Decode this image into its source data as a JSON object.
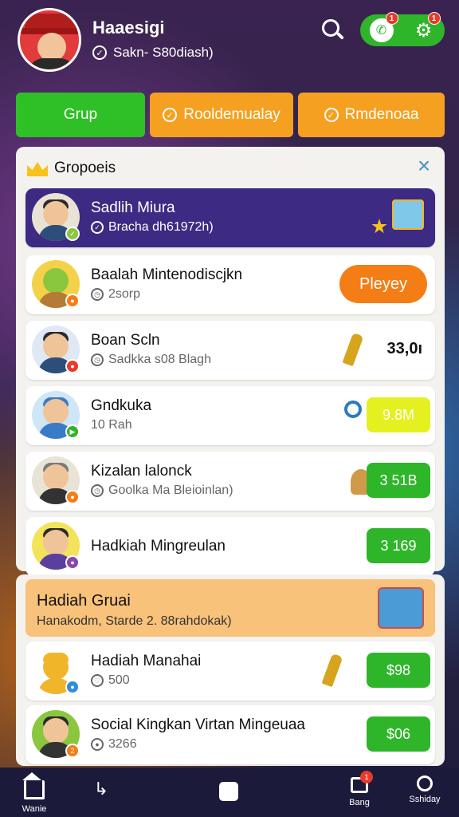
{
  "profile": {
    "name": "Haaesigi",
    "subtitle": "Sakn- S80diash)",
    "subtitle_icon": "check-circle-icon"
  },
  "header_actions": {
    "search_icon": "search-icon",
    "left_badge": "1",
    "right_badge": "1",
    "left_icon": "phone-icon",
    "right_icon": "gear-icon"
  },
  "tabs": [
    {
      "label": "Grup",
      "color": "#2fbf27"
    },
    {
      "label": "Rooldemualay",
      "color": "#f5a020"
    },
    {
      "label": "Rmdenoaa",
      "color": "#f5a020"
    }
  ],
  "panel": {
    "title": "Gropoeis",
    "rows": [
      {
        "title": "Sadlih Miura",
        "subtitle": "Bracha dh61972h)",
        "featured": true
      },
      {
        "title": "Baalah Mintenodiscjkn",
        "subtitle": "2sorp",
        "action": "Pleyey"
      },
      {
        "title": "Boan Scln",
        "subtitle": "Sadkka s08 Blagh",
        "value": "33,0ı"
      },
      {
        "title": "Gndkuka",
        "subtitle": "10 Rah",
        "action": "9.8M"
      },
      {
        "title": "Kizalan lalonck",
        "subtitle": "Goolka Ma Bleioinlan)",
        "action": "3 51B"
      },
      {
        "title": "Hadkiah Mingreulan",
        "action": "3 169"
      }
    ]
  },
  "section2": {
    "banner_title": "Hadiah Gruai",
    "banner_subtitle": "Hanakodm, Starde 2. 88rahdokak)",
    "rows": [
      {
        "title": "Hadiah Manahai",
        "subtitle": "500",
        "action": "$98"
      },
      {
        "title": "Social Kingkan Virtan Mingeuaa",
        "subtitle": "3266",
        "action": "$06"
      }
    ]
  },
  "bottom_nav": {
    "items": [
      {
        "label": "Wanie",
        "icon": "home-icon"
      },
      {
        "label": "",
        "icon": "back-icon"
      },
      {
        "label": "",
        "icon": "stop-icon"
      },
      {
        "label": "Bang",
        "icon": "store-icon",
        "badge": "1"
      },
      {
        "label": "Sshiday",
        "icon": "user-icon"
      }
    ]
  }
}
